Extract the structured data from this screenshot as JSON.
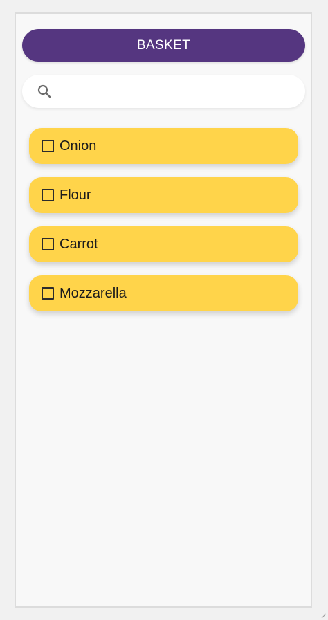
{
  "header": {
    "title": "BASKET"
  },
  "search": {
    "placeholder": "",
    "value": ""
  },
  "items": [
    {
      "label": "Onion",
      "checked": false
    },
    {
      "label": "Flour",
      "checked": false
    },
    {
      "label": "Carrot",
      "checked": false
    },
    {
      "label": "Mozzarella",
      "checked": false
    }
  ],
  "colors": {
    "header_bg": "#553680",
    "item_bg": "#ffd44a",
    "page_bg": "#f8f8f8"
  }
}
